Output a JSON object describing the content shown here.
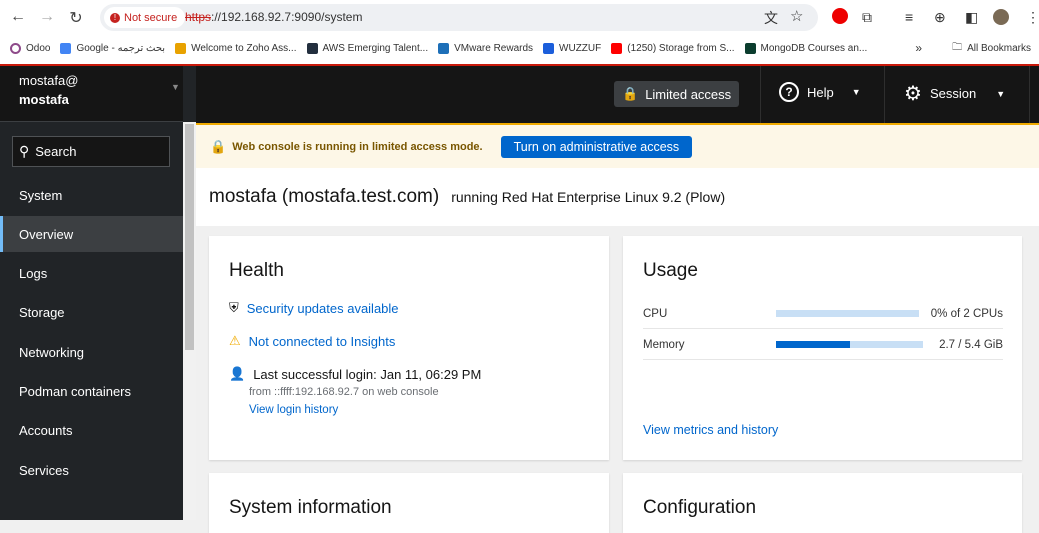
{
  "browser": {
    "not_secure": "Not secure",
    "url_scheme": "https",
    "url_rest": "://192.168.92.7:9090/system",
    "bookmarks": [
      {
        "label": "Odoo",
        "color": "#8e4a8a"
      },
      {
        "label": "Google - بحث ترجمه",
        "color": "#4285f4"
      },
      {
        "label": "Welcome to Zoho Ass...",
        "color": "#e8a200"
      },
      {
        "label": "AWS Emerging Talent...",
        "color": "#232f3e"
      },
      {
        "label": "VMware Rewards",
        "color": "#1d6fb8"
      },
      {
        "label": "WUZZUF",
        "color": "#1b5edb"
      },
      {
        "label": "(1250) Storage from S...",
        "color": "#ff0000"
      },
      {
        "label": "MongoDB Courses an...",
        "color": "#0b3d2e"
      }
    ],
    "more": "»",
    "all_bookmarks": "All Bookmarks"
  },
  "sidebar": {
    "user_line": "mostafa@",
    "host_line": "mostafa",
    "search_label": "Search",
    "items": [
      {
        "label": "System",
        "active": false
      },
      {
        "label": "Overview",
        "active": true
      },
      {
        "label": "Logs",
        "active": false
      },
      {
        "label": "Storage",
        "active": false
      },
      {
        "label": "Networking",
        "active": false
      },
      {
        "label": "Podman containers",
        "active": false
      },
      {
        "label": "Accounts",
        "active": false
      },
      {
        "label": "Services",
        "active": false
      }
    ]
  },
  "topbar": {
    "limited_access": "Limited access",
    "help": "Help",
    "session": "Session"
  },
  "alert": {
    "message": "Web console is running in limited access mode.",
    "button": "Turn on administrative access"
  },
  "title": {
    "host": "mostafa (mostafa.test.com)",
    "os": "running Red Hat Enterprise Linux 9.2 (Plow)"
  },
  "health": {
    "title": "Health",
    "security": "Security updates available",
    "insights": "Not connected to Insights",
    "last_login": "Last successful login: Jan 11, 06:29 PM",
    "from": "from ::ffff:192.168.92.7 on web console",
    "history": "View login history"
  },
  "usage": {
    "title": "Usage",
    "rows": [
      {
        "label": "CPU",
        "value": "0% of 2 CPUs",
        "percent": 0
      },
      {
        "label": "Memory",
        "value": "2.7 / 5.4 GiB",
        "percent": 50
      }
    ],
    "metrics_link": "View metrics and history"
  },
  "cards": {
    "system_info": "System information",
    "configuration": "Configuration"
  }
}
